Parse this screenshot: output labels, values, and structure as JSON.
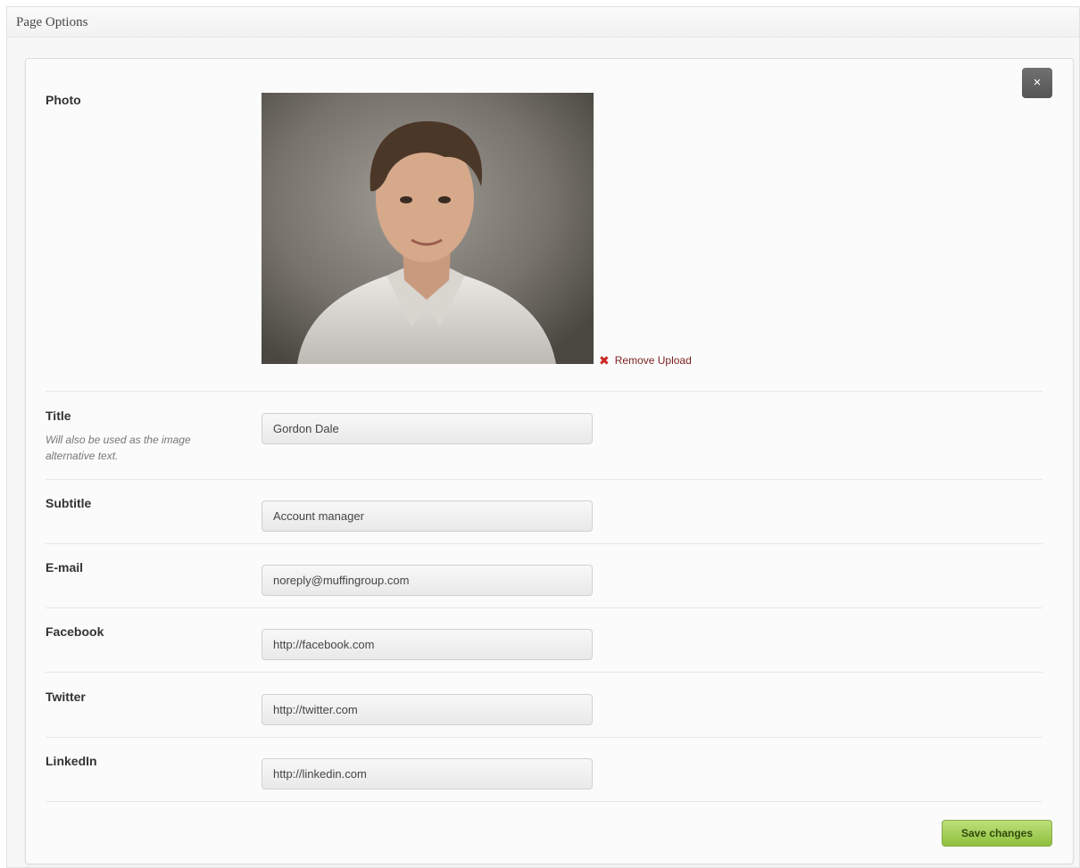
{
  "box": {
    "title": "Page Options"
  },
  "close_label": "×",
  "fields": {
    "photo": {
      "label": "Photo",
      "remove_label": "Remove Upload"
    },
    "title": {
      "label": "Title",
      "description": "Will also be used as the image alternative text.",
      "value": "Gordon Dale"
    },
    "subtitle": {
      "label": "Subtitle",
      "value": "Account manager"
    },
    "email": {
      "label": "E-mail",
      "value": "noreply@muffingroup.com"
    },
    "facebook": {
      "label": "Facebook",
      "value": "http://facebook.com"
    },
    "twitter": {
      "label": "Twitter",
      "value": "http://twitter.com"
    },
    "linkedin": {
      "label": "LinkedIn",
      "value": "http://linkedin.com"
    }
  },
  "save_label": "Save changes",
  "colors": {
    "save_button": "#a6d25a",
    "close_button": "#5e5e5e",
    "remove_link": "#7a1f1f"
  }
}
